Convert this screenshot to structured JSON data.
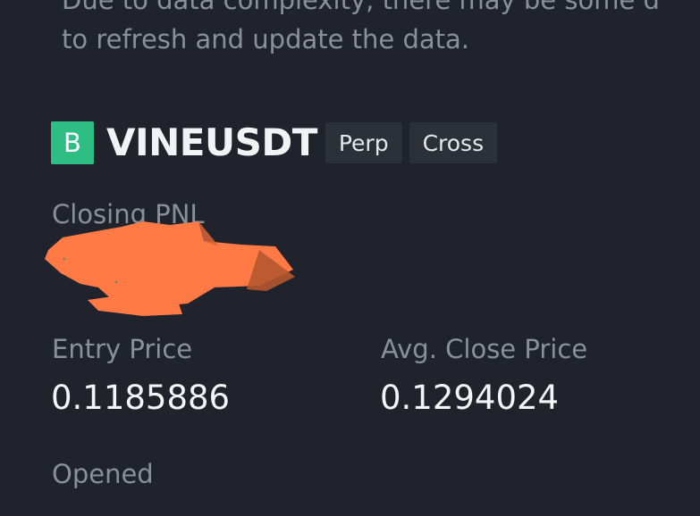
{
  "notice": {
    "line1": "Due to data complexity, there may be some d",
    "line2": "to refresh and update the data."
  },
  "position": {
    "side_badge": "B",
    "symbol": "VINEUSDT",
    "tags": [
      "Perp",
      "Cross"
    ]
  },
  "pnl": {
    "label": "Closing PNL"
  },
  "prices": {
    "entry_label": "Entry Price",
    "entry_value": "0.1185886",
    "avg_close_label": "Avg. Close Price",
    "avg_close_value": "0.1294024"
  },
  "opened": {
    "label": "Opened"
  },
  "colors": {
    "background": "#20232b",
    "buy_badge": "#2ebd85",
    "tag_background": "#2c3039",
    "muted_text": "#8a9099",
    "redaction": "#ff7a45"
  }
}
